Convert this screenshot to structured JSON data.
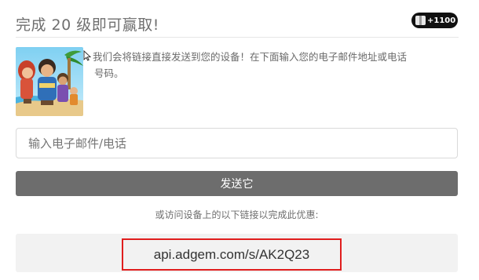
{
  "header": {
    "title": "完成 20 级即可赢取!",
    "reward_amount": "+1100",
    "reward_icon": "gift-icon"
  },
  "offer": {
    "image": "game-characters-art",
    "description_line1": "我们会将链接直接发送到您的设备！在下面输入您的电子邮件地址或电话",
    "description_line2": "号码。"
  },
  "form": {
    "contact_placeholder": "输入电子邮件/电话",
    "contact_value": "",
    "send_label": "发送它"
  },
  "alternative": {
    "text": "或访问设备上的以下链接以完成此优惠:",
    "link": "api.adgem.com/s/AK2Q23",
    "highlight_color": "#e01e1e"
  },
  "colors": {
    "button_bg": "#6d6d6d",
    "badge_bg": "#111111",
    "link_box_bg": "#f2f2f2"
  }
}
